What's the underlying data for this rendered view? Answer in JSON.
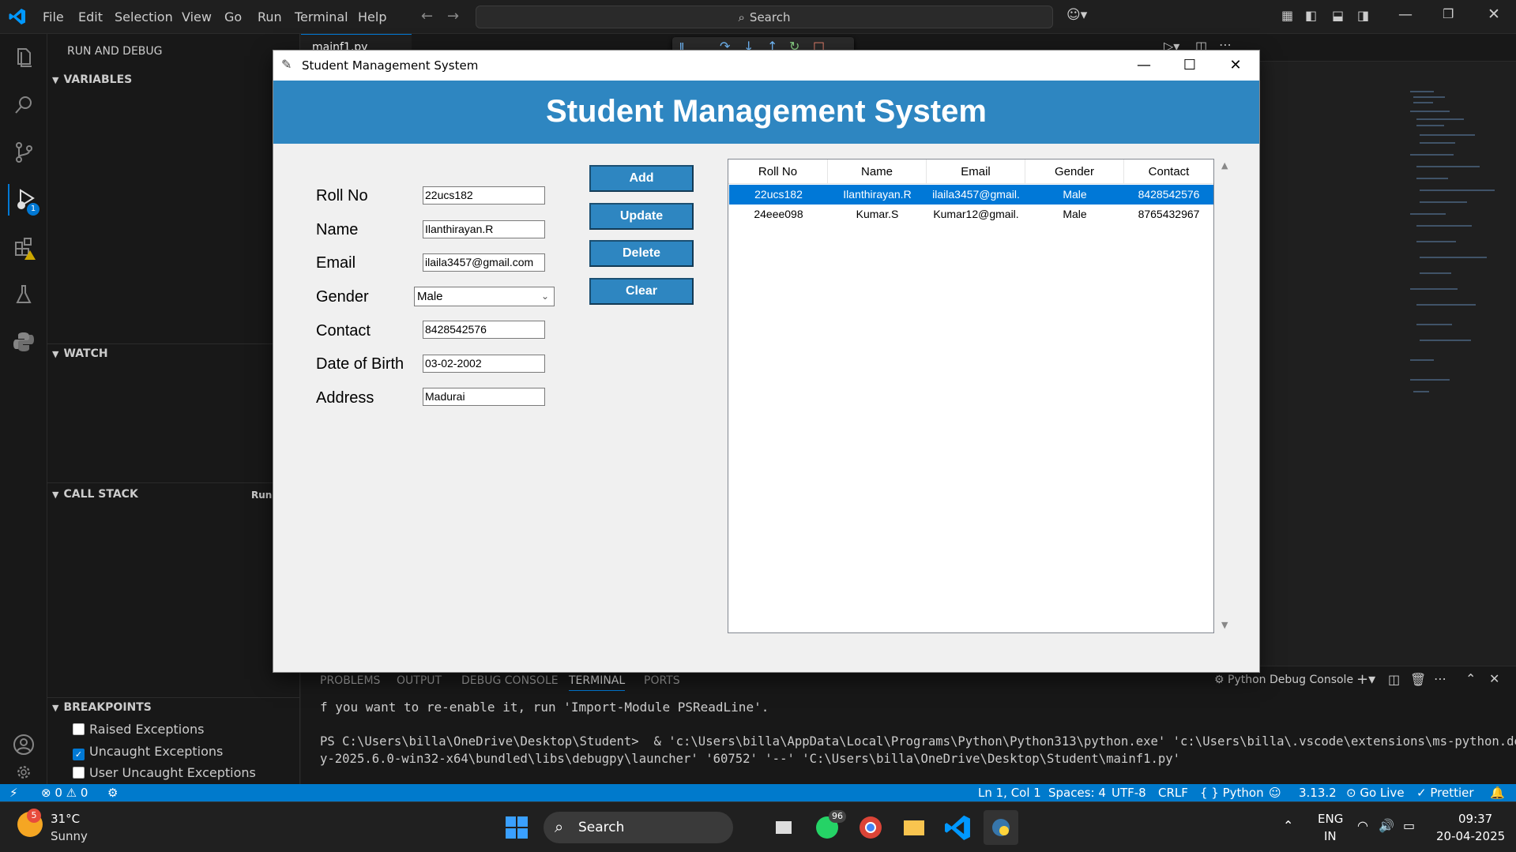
{
  "vscode": {
    "menu": [
      "File",
      "Edit",
      "Selection",
      "View",
      "Go",
      "Run",
      "Terminal",
      "Help"
    ],
    "search_label": "Search",
    "editor_tab": "mainf1.py",
    "sidebar": {
      "title": "RUN AND DEBUG",
      "variables": "VARIABLES",
      "watch": "WATCH",
      "call_stack": "CALL STACK",
      "call_stack_status": "Runn",
      "breakpoints": "BREAKPOINTS",
      "breakpoint_items": [
        {
          "label": "Raised Exceptions",
          "checked": false
        },
        {
          "label": "Uncaught Exceptions",
          "checked": true
        },
        {
          "label": "User Uncaught Exceptions",
          "checked": false
        }
      ]
    },
    "activity_badge": "1",
    "panel": {
      "tabs": [
        "PROBLEMS",
        "OUTPUT",
        "DEBUG CONSOLE",
        "TERMINAL",
        "PORTS"
      ],
      "active_tab": "TERMINAL",
      "terminal_name": "Python Debug Console",
      "lines": [
        "f you want to re-enable it, run 'Import-Module PSReadLine'.",
        "",
        "PS C:\\Users\\billa\\OneDrive\\Desktop\\Student>  & 'c:\\Users\\billa\\AppData\\Local\\Programs\\Python\\Python313\\python.exe' 'c:\\Users\\billa\\.vscode\\extensions\\ms-python.debugp",
        "y-2025.6.0-win32-x64\\bundled\\libs\\debugpy\\launcher' '60752' '--' 'C:\\Users\\billa\\OneDrive\\Desktop\\Student\\mainf1.py'"
      ]
    },
    "statusbar": {
      "errors": "0",
      "warnings": "0",
      "position": "Ln 1, Col 1",
      "spaces": "Spaces: 4",
      "encoding": "UTF-8",
      "eol": "CRLF",
      "language": "Python",
      "python_version": "3.13.2",
      "golive": "Go Live",
      "prettier": "Prettier"
    }
  },
  "app": {
    "window_title": "Student Management System",
    "banner": "Student Management System",
    "form": {
      "fields": [
        {
          "label": "Roll No",
          "value": "22ucs182"
        },
        {
          "label": "Name",
          "value": "Ilanthirayan.R"
        },
        {
          "label": "Email",
          "value": "ilaila3457@gmail.com"
        },
        {
          "label": "Gender",
          "value": "Male"
        },
        {
          "label": "Contact",
          "value": "8428542576"
        },
        {
          "label": "Date of Birth",
          "value": "03-02-2002"
        },
        {
          "label": "Address",
          "value": "Madurai"
        }
      ]
    },
    "buttons": {
      "add": "Add",
      "update": "Update",
      "delete": "Delete",
      "clear": "Clear"
    },
    "table": {
      "columns": [
        "Roll No",
        "Name",
        "Email",
        "Gender",
        "Contact"
      ],
      "rows": [
        [
          "22ucs182",
          "Ilanthirayan.R",
          "ilaila3457@gmail.",
          "Male",
          "8428542576"
        ],
        [
          "24eee098",
          "Kumar.S",
          "Kumar12@gmail.",
          "Male",
          "8765432967"
        ]
      ],
      "selected_row": 0
    }
  },
  "taskbar": {
    "weather_temp": "31°C",
    "weather_desc": "Sunny",
    "weather_badge": "5",
    "search_label": "Search",
    "whatsapp_badge": "96",
    "lang_top": "ENG",
    "lang_bottom": "IN",
    "time": "09:37",
    "date": "20-04-2025"
  },
  "colors": {
    "accent": "#007acc",
    "banner": "#2e86c1",
    "selection": "#0078d7"
  }
}
